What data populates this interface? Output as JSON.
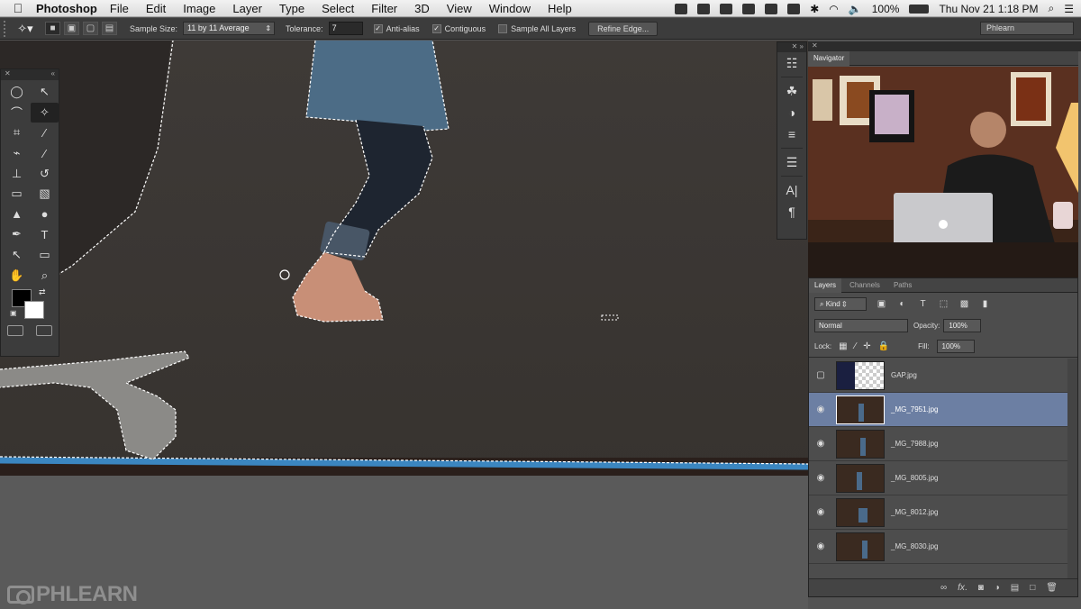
{
  "menubar": {
    "apple_icon": "apple-logo-icon",
    "app_name": "Photoshop",
    "items": [
      "File",
      "Edit",
      "Image",
      "Layer",
      "Type",
      "Select",
      "Filter",
      "3D",
      "View",
      "Window",
      "Help"
    ],
    "battery": "100%",
    "clock": "Thu Nov 21  1:18 PM",
    "user": "Phlearn"
  },
  "options": {
    "tool_icon": "magic-wand-icon",
    "sample_size_label": "Sample Size:",
    "sample_size_value": "11 by 11 Average",
    "tolerance_label": "Tolerance:",
    "tolerance_value": "7",
    "anti_alias_label": "Anti-alias",
    "contiguous_label": "Contiguous",
    "sample_all_label": "Sample All Layers",
    "refine_edge_label": "Refine Edge...",
    "workspace": "Phlearn"
  },
  "panels": {
    "navigator_tab": "Navigator",
    "layers_tab": "Layers",
    "channels_tab": "Channels",
    "paths_tab": "Paths"
  },
  "layers_panel": {
    "kind_label": "Kind",
    "blend_mode": "Normal",
    "opacity_label": "Opacity:",
    "opacity_value": "100%",
    "lock_label": "Lock:",
    "fill_label": "Fill:",
    "fill_value": "100%",
    "layers": [
      {
        "name": "GAP.jpg",
        "visible": false,
        "selected": false
      },
      {
        "name": "_MG_7951.jpg",
        "visible": true,
        "selected": true
      },
      {
        "name": "_MG_7988.jpg",
        "visible": true,
        "selected": false
      },
      {
        "name": "_MG_8005.jpg",
        "visible": true,
        "selected": false
      },
      {
        "name": "_MG_8012.jpg",
        "visible": true,
        "selected": false
      },
      {
        "name": "_MG_8030.jpg",
        "visible": true,
        "selected": false
      }
    ]
  },
  "watermark": "PHLEARN",
  "colors": {
    "selection_highlight": "#6c7fa3",
    "panel_bg": "#535353",
    "canvas_bg": "#3c3835"
  }
}
